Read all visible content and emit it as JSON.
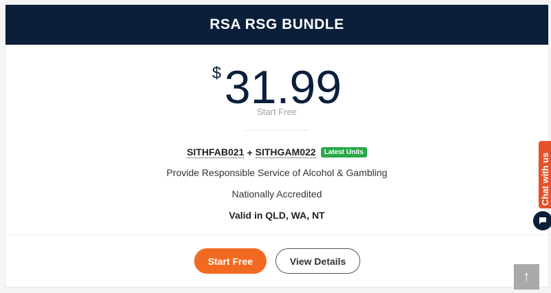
{
  "card": {
    "title": "RSA RSG BUNDLE",
    "price": {
      "currency": "$",
      "amount": "31.99",
      "subtitle": "Start Free"
    },
    "units": {
      "code1": "SITHFAB021",
      "separator": "+",
      "code2": "SITHGAM022",
      "badge": "Latest Units"
    },
    "features": [
      "Provide Responsible Service of Alcohol & Gambling",
      "Nationally Accredited",
      "Valid in QLD, WA, NT"
    ],
    "buttons": {
      "start": "Start Free",
      "view": "View Details"
    }
  },
  "chat": {
    "tab_label": "Chat with us",
    "bubble_icon": "chat-icon"
  },
  "scroll_top": {
    "icon": "arrow-up-icon",
    "glyph": "↑"
  },
  "colors": {
    "header": "#0b1f3a",
    "accent": "#f26a21",
    "badge": "#28a745",
    "chat": "#e5522b"
  }
}
